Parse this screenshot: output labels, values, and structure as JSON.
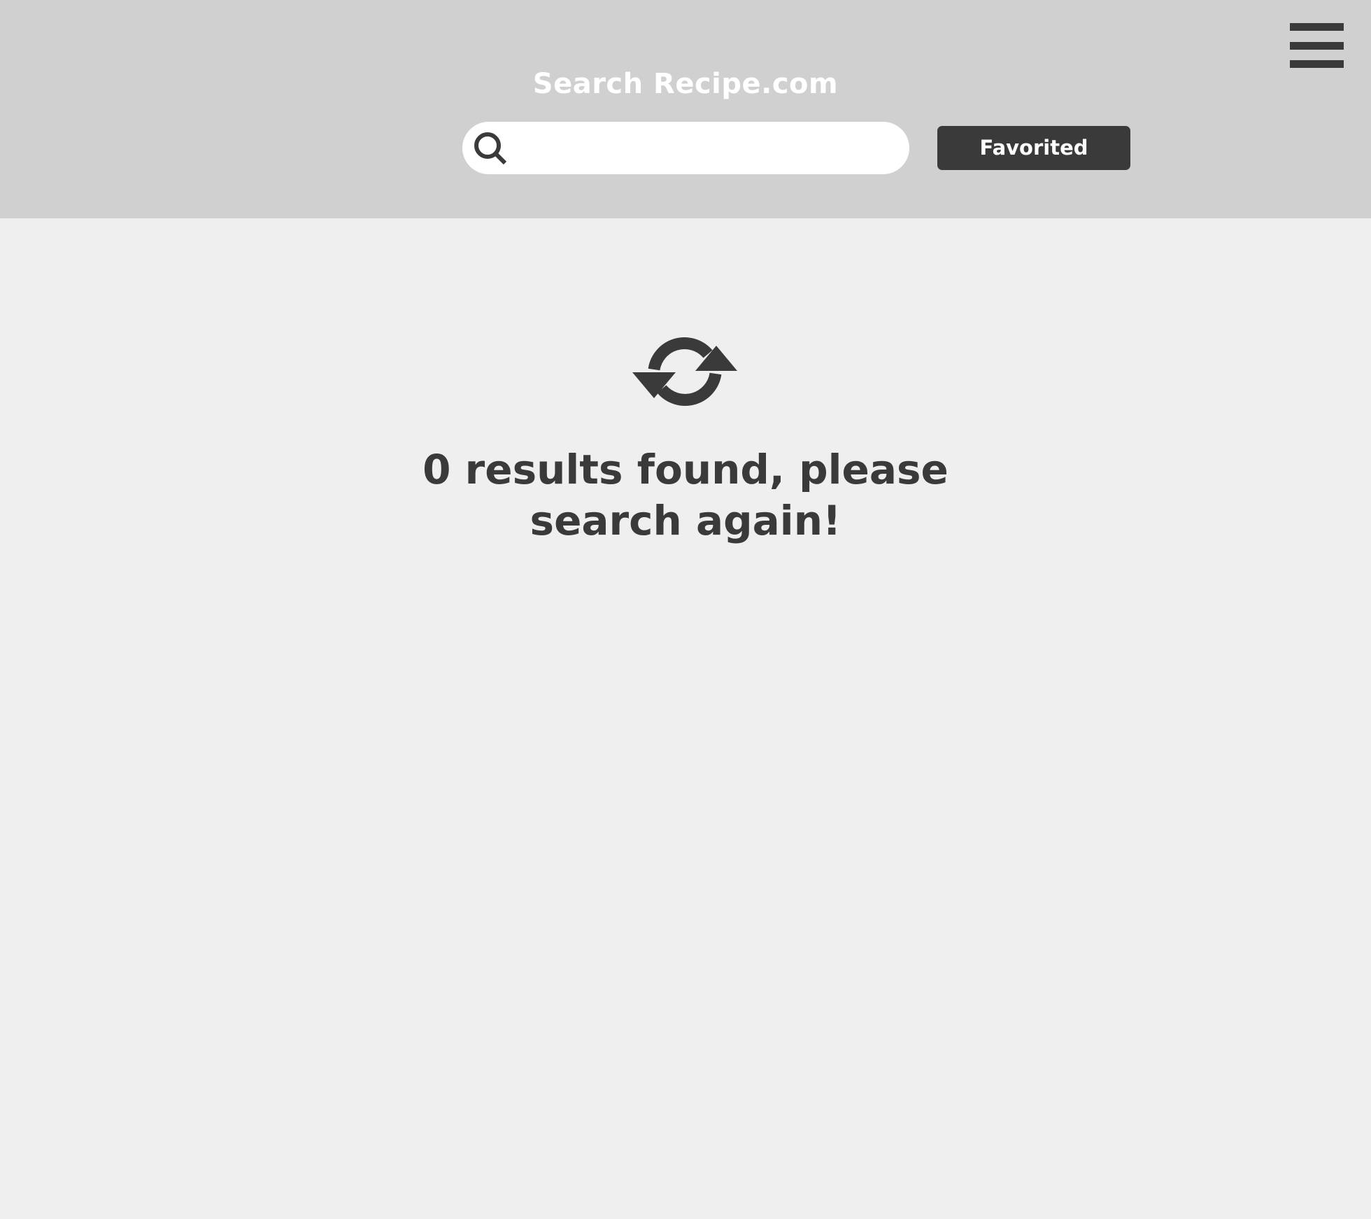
{
  "header": {
    "title": "Search Recipe.com",
    "search": {
      "value": "",
      "placeholder": ""
    },
    "favorited_label": "Favorited",
    "menu_icon": "hamburger-menu-icon"
  },
  "main": {
    "status_icon": "refresh-icon",
    "message_line1": "0 results found, please",
    "message_line2": "search again!"
  },
  "colors": {
    "header_bg": "#d0d0d0",
    "page_bg": "#efefef",
    "dark": "#3a3a3a",
    "white": "#ffffff"
  }
}
